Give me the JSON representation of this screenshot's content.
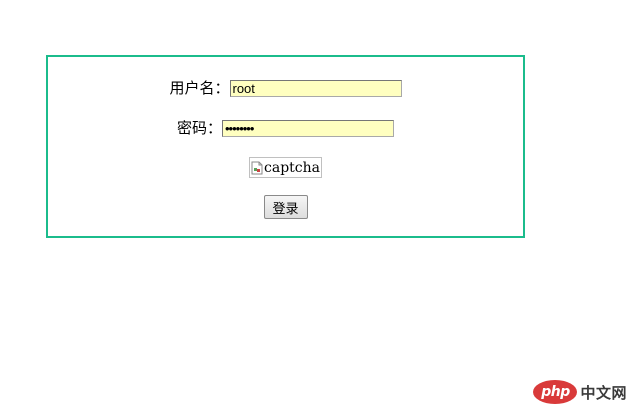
{
  "form": {
    "username_label": "用户名：",
    "username_value": "root",
    "password_label": "密码：",
    "password_value": "••••••••",
    "captcha_alt": "captcha",
    "submit_label": "登录"
  },
  "watermark": {
    "logo_text": "php",
    "site_text": "中文网"
  },
  "colors": {
    "box_border": "#1bbc8c",
    "autofill_bg": "#ffffc0",
    "watermark_red": "#d93a3a"
  }
}
